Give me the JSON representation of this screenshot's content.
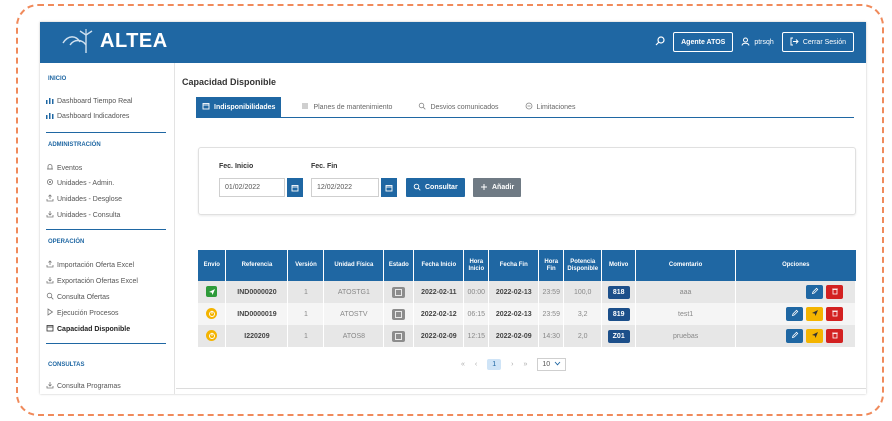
{
  "header": {
    "logo_text": "ALTEA",
    "agent_label": "Agente ATOS",
    "user": "ptrsqh",
    "logout_label": "Cerrar Sesión",
    "brand_color": "#1f67a3"
  },
  "sidebar": {
    "sections": [
      {
        "title": "INICIO",
        "items": [
          "Dashboard Tiempo Real",
          "Dashboard Indicadores"
        ]
      },
      {
        "title": "ADMINISTRACIÓN",
        "items": [
          "Eventos",
          "Unidades - Admin.",
          "Unidades - Desglose",
          "Unidades - Consulta"
        ]
      },
      {
        "title": "OPERACIÓN",
        "items": [
          "Importación Oferta Excel",
          "Exportación Ofertas Excel",
          "Consulta Ofertas",
          "Ejecución Procesos",
          "Capacidad Disponible"
        ]
      },
      {
        "title": "CONSULTAS",
        "items": [
          "Consulta Programas"
        ]
      }
    ]
  },
  "main": {
    "title": "Capacidad Disponible",
    "tabs": [
      "Indisponibilidades",
      "Planes de mantenimiento",
      "Desvios comunicados",
      "Limitaciones"
    ],
    "filter": {
      "start_label": "Fec. Inicio",
      "start_value": "01/02/2022",
      "end_label": "Fec. Fin",
      "end_value": "12/02/2022",
      "search_label": "Consultar",
      "add_label": "Añadir"
    },
    "table": {
      "headers": [
        "Envío",
        "Referencia",
        "Versión",
        "Unidad Física",
        "Estado",
        "Fecha Inicio",
        "Hora Inicio",
        "Fecha Fin",
        "Hora Fin",
        "Potencia Disponible",
        "Motivo",
        "Comentario",
        "Opciones"
      ],
      "rows": [
        {
          "envio": "sent",
          "ref": "IND0000020",
          "version": "1",
          "unidad": "ATOSTG1",
          "fecha_inicio": "2022-02-11",
          "hora_inicio": "00:00",
          "fecha_fin": "2022-02-13",
          "hora_fin": "23:59",
          "potencia": "100,0",
          "motivo": "818",
          "comentario": "aaa"
        },
        {
          "envio": "pending",
          "ref": "IND0000019",
          "version": "1",
          "unidad": "ATOSTV",
          "fecha_inicio": "2022-02-12",
          "hora_inicio": "06:15",
          "fecha_fin": "2022-02-13",
          "hora_fin": "23:59",
          "potencia": "3,2",
          "motivo": "819",
          "comentario": "test1"
        },
        {
          "envio": "pending",
          "ref": "I220209",
          "version": "1",
          "unidad": "ATOS8",
          "fecha_inicio": "2022-02-09",
          "hora_inicio": "12:15",
          "fecha_fin": "2022-02-09",
          "hora_fin": "14:30",
          "potencia": "2,0",
          "motivo": "Z01",
          "comentario": "pruebas"
        }
      ]
    },
    "pager": {
      "current": "1",
      "page_size": "10"
    }
  }
}
